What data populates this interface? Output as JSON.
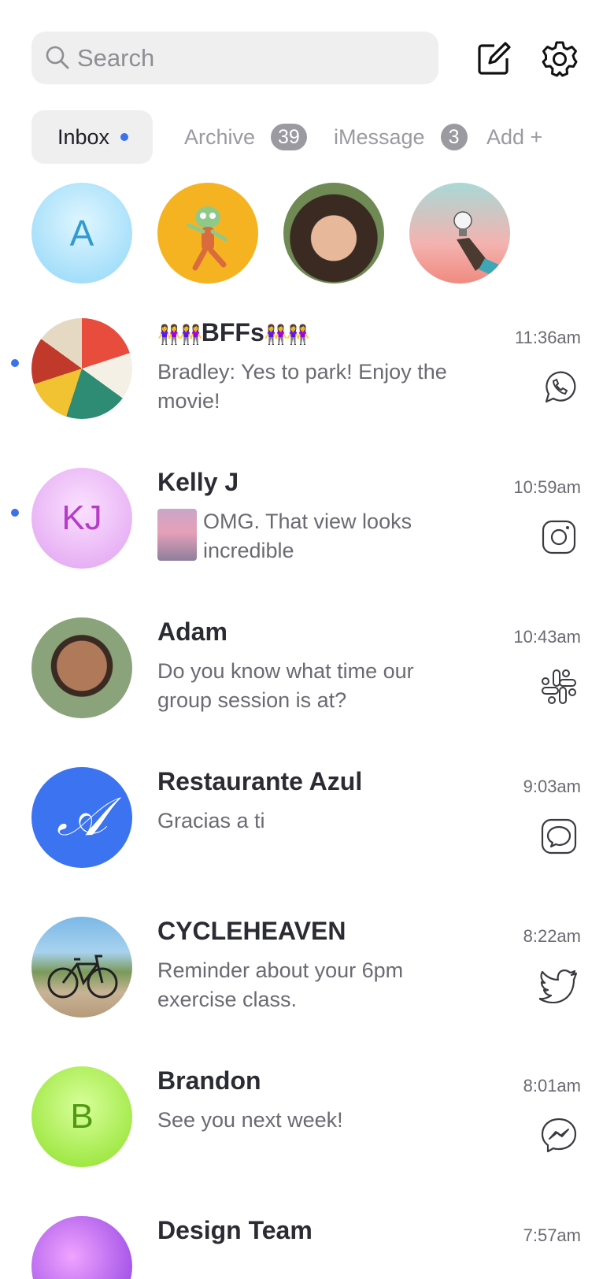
{
  "search": {
    "placeholder": "Search"
  },
  "tabs": [
    {
      "label": "Inbox"
    },
    {
      "label": "Archive",
      "badge": "39"
    },
    {
      "label": "iMessage",
      "badge": "3"
    },
    {
      "label": "Add +"
    }
  ],
  "stories": {
    "letter_avatar": "A"
  },
  "conversations": [
    {
      "name": "BFFs",
      "preview": "Bradley: Yes to park! Enjoy the movie!",
      "time": "11:36am",
      "platform": "whatsapp-icon",
      "unread": true
    },
    {
      "name": "Kelly J",
      "initials": "KJ",
      "preview": "OMG. That view looks incredible",
      "time": "10:59am",
      "platform": "instagram-icon",
      "unread": true
    },
    {
      "name": "Adam",
      "preview": "Do you know what time our group session is at?",
      "time": "10:43am",
      "platform": "slack-icon",
      "unread": false
    },
    {
      "name": "Restaurante Azul",
      "preview": "Gracias a ti",
      "time": "9:03am",
      "platform": "message-bubble-icon",
      "unread": false
    },
    {
      "name": "CYCLEHEAVEN",
      "preview": "Reminder about your 6pm exercise class.",
      "time": "8:22am",
      "platform": "twitter-icon",
      "unread": false
    },
    {
      "name": "Brandon",
      "initials": "B",
      "preview": "See you next week!",
      "time": "8:01am",
      "platform": "messenger-icon",
      "unread": false
    },
    {
      "name": "Design Team",
      "preview": "",
      "time": "7:57am",
      "platform": "",
      "unread": false
    }
  ],
  "colors": {
    "accent": "#3a73ec",
    "text_primary": "#2b2b33",
    "text_secondary": "#6a6a72",
    "surface": "#efeff0"
  }
}
